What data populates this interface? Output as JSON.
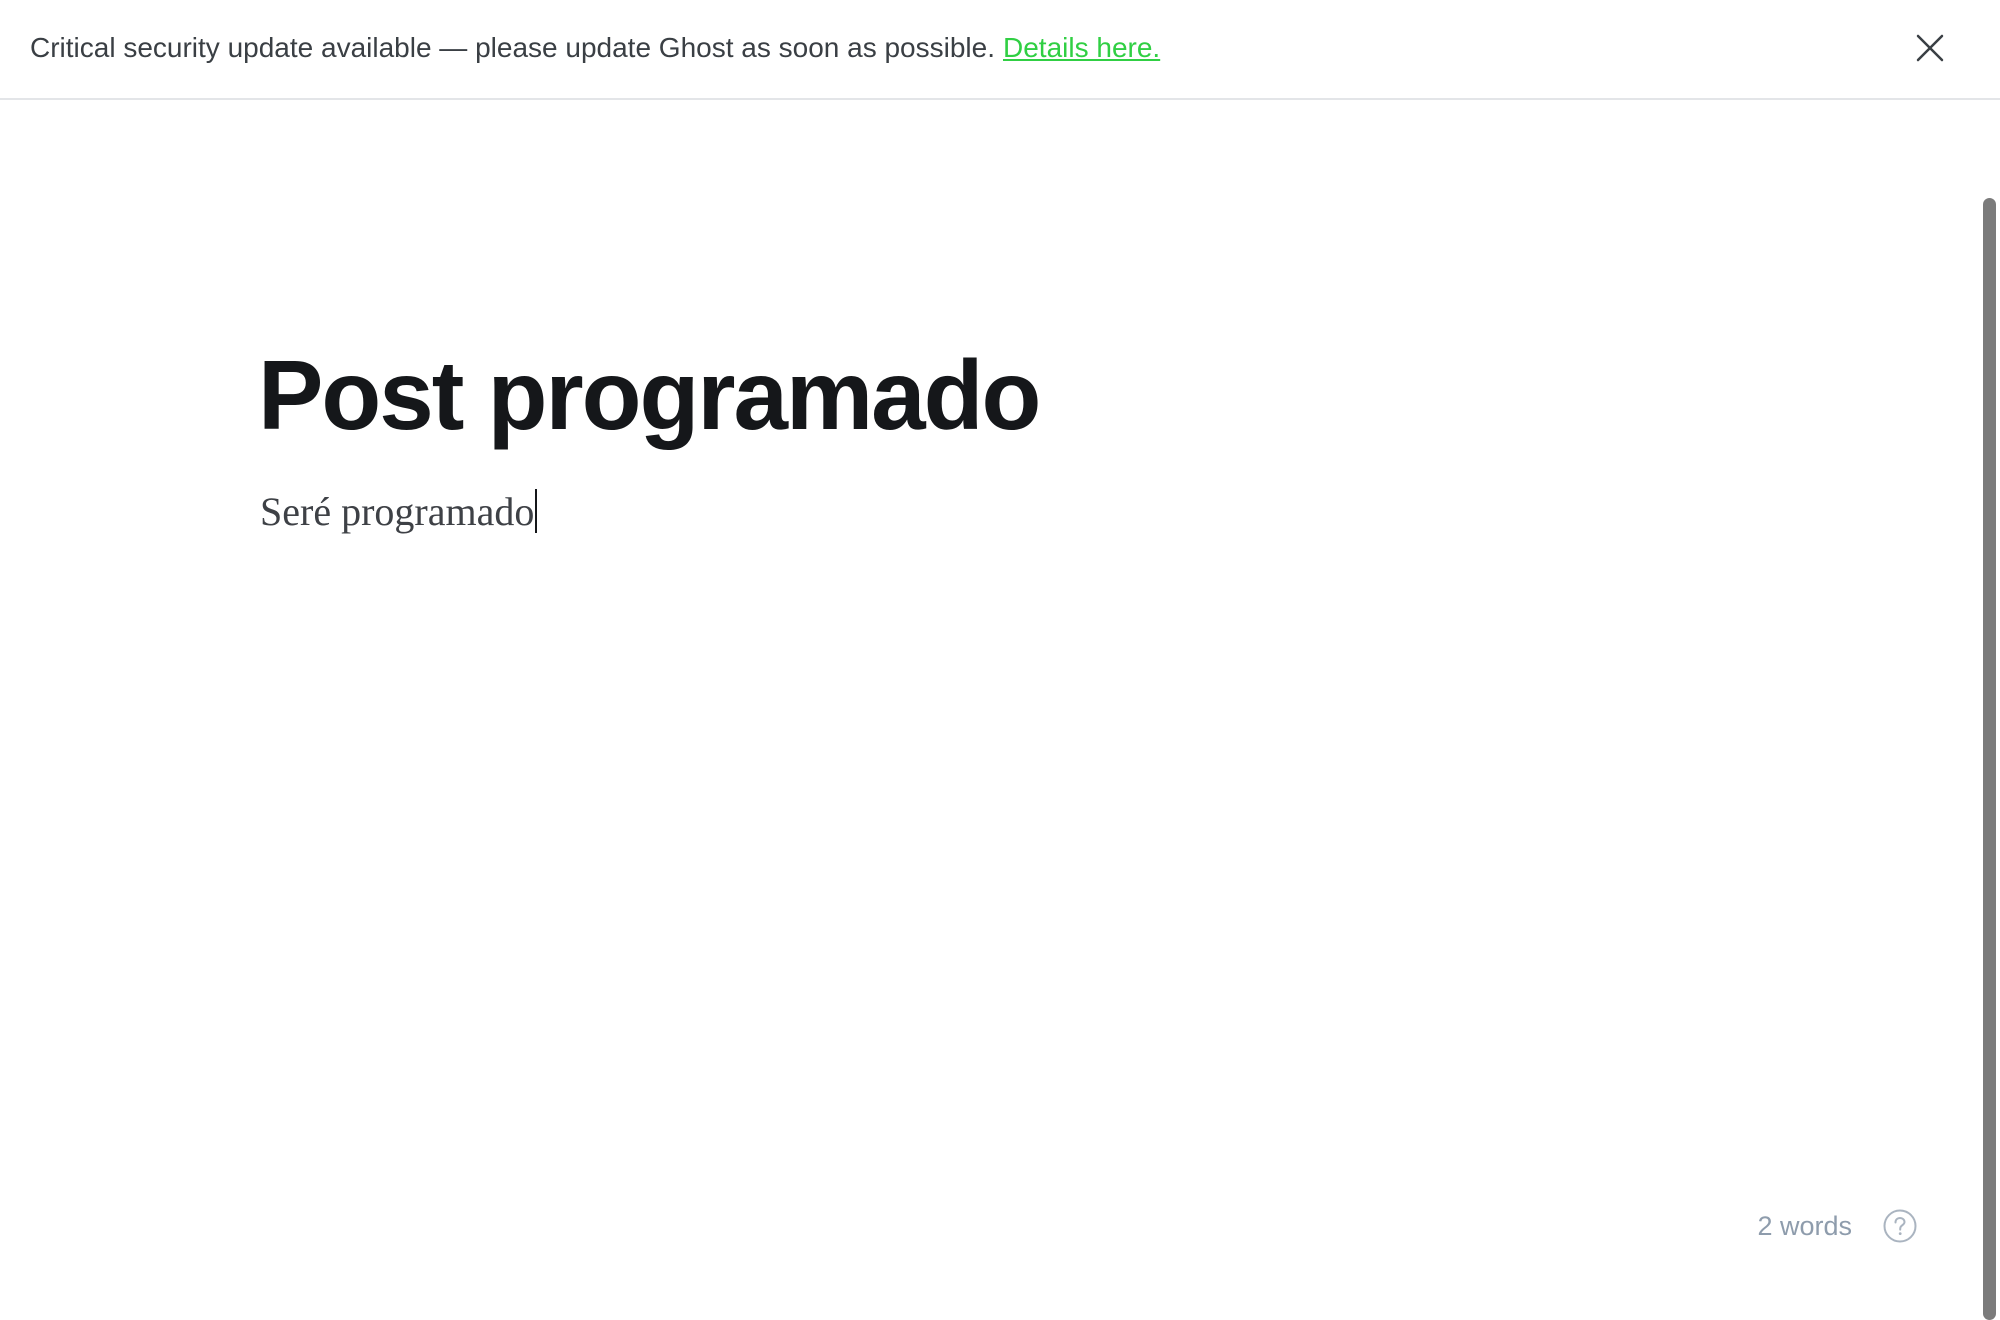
{
  "alert": {
    "message": "Critical security update available — please update Ghost as soon as possible.",
    "link_text": "Details here.",
    "close_icon": "close-icon"
  },
  "editor": {
    "title": "Post programado",
    "body": "Seré programado"
  },
  "status": {
    "word_count": "2 words",
    "help_icon": "help-icon"
  },
  "colors": {
    "link": "#30cf43",
    "title": "#15171a",
    "muted": "#8e9cac"
  }
}
